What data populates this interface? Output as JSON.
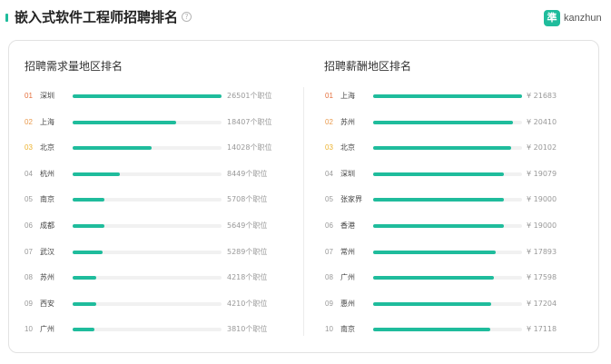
{
  "header": {
    "title": "嵌入式软件工程师招聘排名",
    "info_icon": "info-circle-icon",
    "logo_mark": "準",
    "logo_text": "kanzhun",
    "accent_color": "#1fbc9c"
  },
  "demand_panel": {
    "title": "招聘需求量地区排名",
    "max": 26501,
    "items": [
      {
        "rank": "01",
        "city": "深圳",
        "count": 26501,
        "label": "26501个职位"
      },
      {
        "rank": "02",
        "city": "上海",
        "count": 18407,
        "label": "18407个职位"
      },
      {
        "rank": "03",
        "city": "北京",
        "count": 14028,
        "label": "14028个职位"
      },
      {
        "rank": "04",
        "city": "杭州",
        "count": 8449,
        "label": "8449个职位"
      },
      {
        "rank": "05",
        "city": "南京",
        "count": 5708,
        "label": "5708个职位"
      },
      {
        "rank": "06",
        "city": "成都",
        "count": 5649,
        "label": "5649个职位"
      },
      {
        "rank": "07",
        "city": "武汉",
        "count": 5289,
        "label": "5289个职位"
      },
      {
        "rank": "08",
        "city": "苏州",
        "count": 4218,
        "label": "4218个职位"
      },
      {
        "rank": "09",
        "city": "西安",
        "count": 4210,
        "label": "4210个职位"
      },
      {
        "rank": "10",
        "city": "广州",
        "count": 3810,
        "label": "3810个职位"
      }
    ]
  },
  "salary_panel": {
    "title": "招聘薪酬地区排名",
    "max": 21683,
    "items": [
      {
        "rank": "01",
        "city": "上海",
        "salary": 21683,
        "label": "¥ 21683"
      },
      {
        "rank": "02",
        "city": "苏州",
        "salary": 20410,
        "label": "¥ 20410"
      },
      {
        "rank": "03",
        "city": "北京",
        "salary": 20102,
        "label": "¥ 20102"
      },
      {
        "rank": "04",
        "city": "深圳",
        "salary": 19079,
        "label": "¥ 19079"
      },
      {
        "rank": "05",
        "city": "张家界",
        "salary": 19000,
        "label": "¥ 19000"
      },
      {
        "rank": "06",
        "city": "香港",
        "salary": 19000,
        "label": "¥ 19000"
      },
      {
        "rank": "07",
        "city": "常州",
        "salary": 17893,
        "label": "¥ 17893"
      },
      {
        "rank": "08",
        "city": "广州",
        "salary": 17598,
        "label": "¥ 17598"
      },
      {
        "rank": "09",
        "city": "惠州",
        "salary": 17204,
        "label": "¥ 17204"
      },
      {
        "rank": "10",
        "city": "南京",
        "salary": 17118,
        "label": "¥ 17118"
      }
    ]
  }
}
